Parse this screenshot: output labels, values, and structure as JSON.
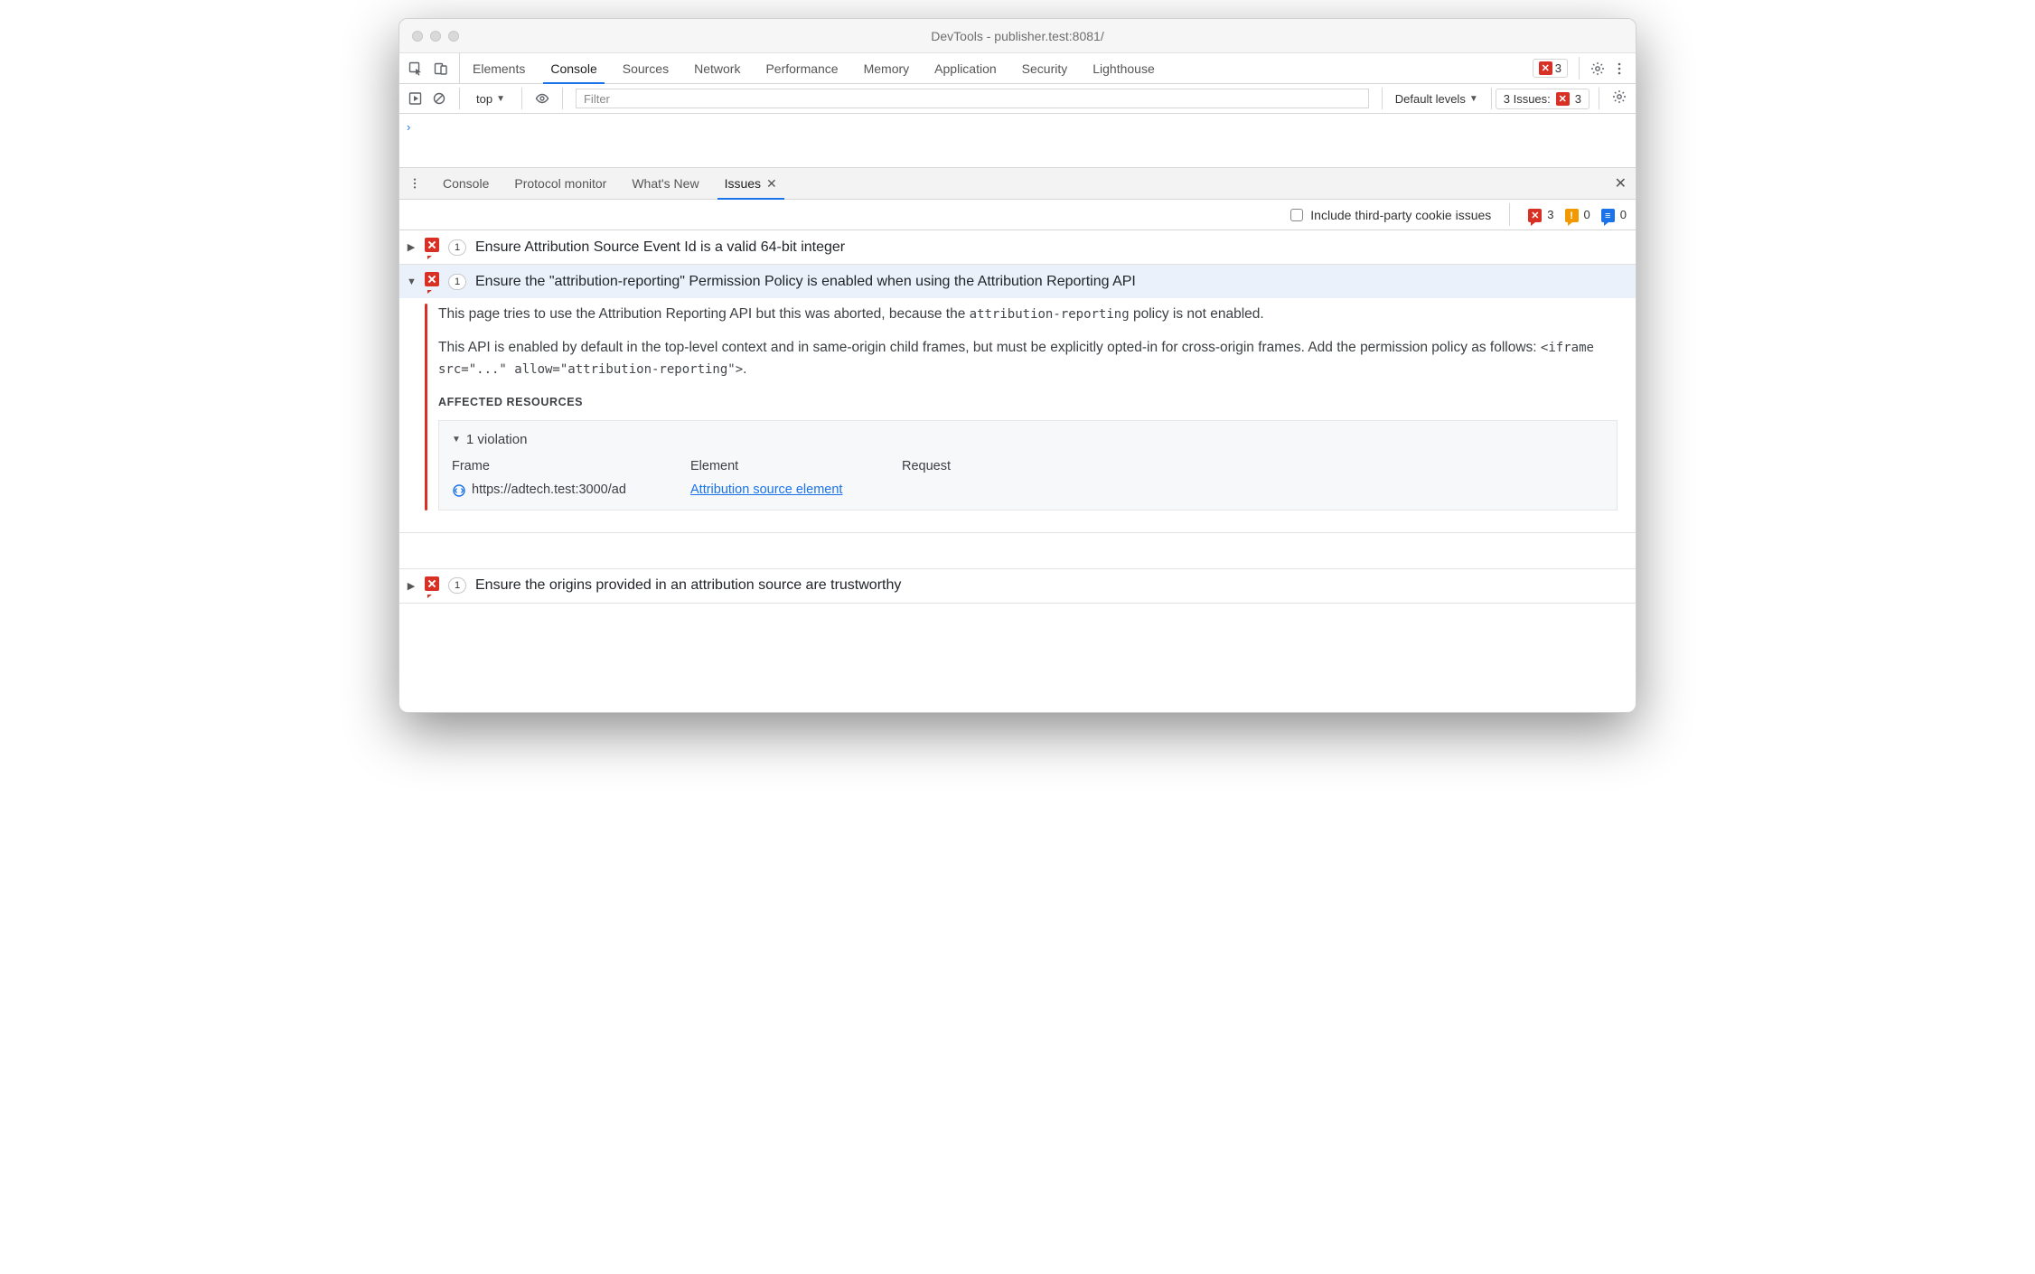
{
  "window": {
    "title": "DevTools - publisher.test:8081/"
  },
  "main_tabs": [
    "Elements",
    "Console",
    "Sources",
    "Network",
    "Performance",
    "Memory",
    "Application",
    "Security",
    "Lighthouse"
  ],
  "main_tabs_active": "Console",
  "top_error_count": "3",
  "console_toolbar": {
    "context": "top",
    "filter_placeholder": "Filter",
    "levels": "Default levels",
    "issues_label": "3 Issues:",
    "issues_count": "3"
  },
  "drawer_tabs": [
    "Console",
    "Protocol monitor",
    "What's New",
    "Issues"
  ],
  "drawer_tabs_active": "Issues",
  "drawer_filter": {
    "checkbox_label": "Include third-party cookie issues",
    "red_count": "3",
    "orange_count": "0",
    "blue_count": "0"
  },
  "issues": [
    {
      "expanded": false,
      "count": "1",
      "title": "Ensure Attribution Source Event Id is a valid 64-bit integer"
    },
    {
      "expanded": true,
      "count": "1",
      "title": "Ensure the \"attribution-reporting\" Permission Policy is enabled when using the Attribution Reporting API",
      "paragraph1_pre": "This page tries to use the Attribution Reporting API but this was aborted, because the ",
      "paragraph1_code": "attribution-reporting",
      "paragraph1_post": " policy is not enabled.",
      "paragraph2_pre": "This API is enabled by default in the top-level context and in same-origin child frames, but must be explicitly opted-in for cross-origin frames. Add the permission policy as follows: ",
      "paragraph2_code": "<iframe src=\"...\" allow=\"attribution-reporting\">",
      "paragraph2_post": ".",
      "affected_heading": "Affected Resources",
      "violation_summary": "1 violation",
      "table": {
        "headers": [
          "Frame",
          "Element",
          "Request"
        ],
        "frame_url": "https://adtech.test:3000/ad",
        "element_link": "Attribution source element"
      }
    },
    {
      "expanded": false,
      "count": "1",
      "title": "Ensure the origins provided in an attribution source are trustworthy"
    }
  ]
}
